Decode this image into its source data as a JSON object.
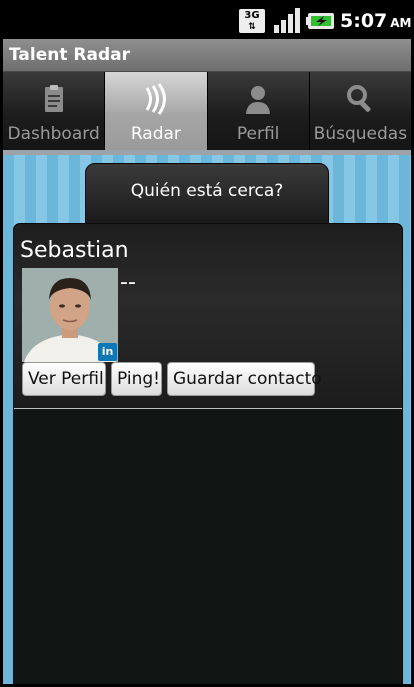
{
  "status_bar": {
    "network_type": "3G",
    "network_arrows": "⇅",
    "signal_icon": "signal-bars-icon",
    "battery_icon": "battery-charging-icon",
    "time": "5:07",
    "ampm": "AM"
  },
  "app": {
    "title": "Talent Radar"
  },
  "tabs": [
    {
      "label": "Dashboard",
      "icon": "clipboard-icon",
      "active": false
    },
    {
      "label": "Radar",
      "icon": "radar-waves-icon",
      "active": true
    },
    {
      "label": "Perfil",
      "icon": "person-icon",
      "active": false
    },
    {
      "label": "Búsquedas",
      "icon": "magnifier-icon",
      "active": false
    }
  ],
  "nearby": {
    "header": "Quién está cerca?",
    "person": {
      "name": "Sebastian",
      "subtitle": "--",
      "badge": "in",
      "buttons": {
        "view_profile": "Ver Perfil",
        "ping": "Ping!",
        "save_contact": "Guardar contacto"
      }
    }
  },
  "colors": {
    "stripe_light": "#86c7e6",
    "stripe_dark": "#6cb6d9",
    "panel": "#111614",
    "linkedin_blue": "#0d78b5"
  }
}
